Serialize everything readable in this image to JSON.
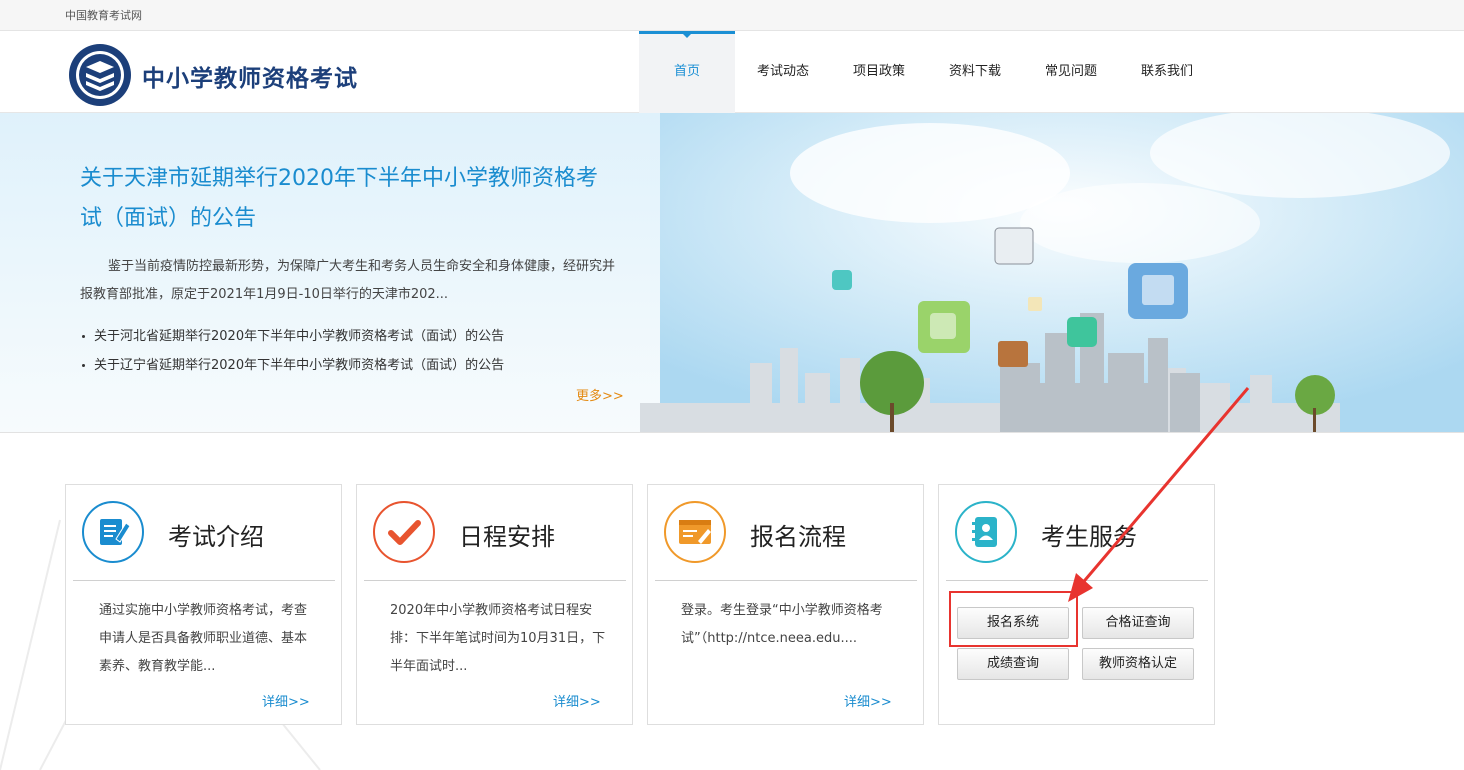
{
  "topbar": {
    "link": "中国教育考试网"
  },
  "header": {
    "site_title": "中小学教师资格考试",
    "nav": [
      "首页",
      "考试动态",
      "项目政策",
      "资料下载",
      "常见问题",
      "联系我们"
    ],
    "active_index": 0
  },
  "banner": {
    "headline": "关于天津市延期举行2020年下半年中小学教师资格考试（面试）的公告",
    "summary": "鉴于当前疫情防控最新形势，为保障广大考生和考务人员生命安全和身体健康，经研究并报教育部批准，原定于2021年1月9日-10日举行的天津市202...",
    "news": [
      "关于河北省延期举行2020年下半年中小学教师资格考试（面试）的公告",
      "关于辽宁省延期举行2020年下半年中小学教师资格考试（面试）的公告"
    ],
    "more": "更多>>"
  },
  "cards": [
    {
      "title": "考试介绍",
      "icon": "document-edit-icon",
      "color": "#1a8ccf",
      "desc": "通过实施中小学教师资格考试，考查申请人是否具备教师职业道德、基本素养、教育教学能...",
      "detail": "详细>>"
    },
    {
      "title": "日程安排",
      "icon": "checkmark-icon",
      "color": "#e8542f",
      "desc": "2020年中小学教师资格考试日程安排：下半年笔试时间为10月31日，下半年面试时...",
      "detail": "详细>>"
    },
    {
      "title": "报名流程",
      "icon": "form-pencil-icon",
      "color": "#f0992a",
      "desc": "登录。考生登录“中小学教师资格考试”（http://ntce.neea.edu....",
      "detail": "详细>>"
    },
    {
      "title": "考生服务",
      "icon": "contact-book-icon",
      "color": "#2bb3c9"
    }
  ],
  "services": [
    "报名系统",
    "合格证查询",
    "成绩查询",
    "教师资格认定"
  ],
  "colors": {
    "accent": "#1a8ccf",
    "more": "#e48a12",
    "annotation": "#e8342f"
  }
}
